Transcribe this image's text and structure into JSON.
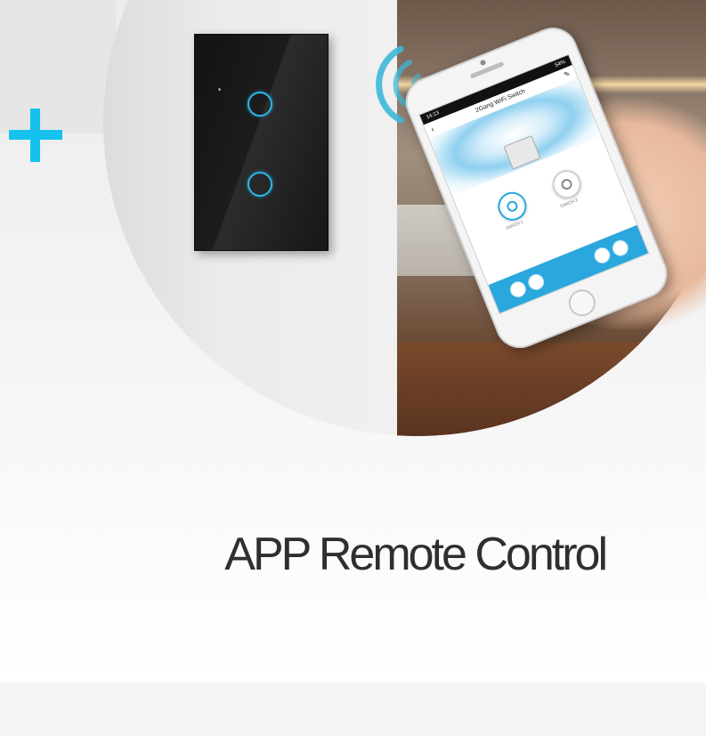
{
  "headline": "APP Remote Control",
  "phone_app": {
    "status_time": "14:13",
    "status_battery": "54%",
    "title": "2Gang WiFi Switch",
    "switch_1_label": "SWICH 1",
    "switch_2_label": "SWICH 2"
  },
  "colors": {
    "accent": "#15c2ee",
    "touch_ring": "#2bb8e8",
    "app_bar": "#2aa7dc",
    "headline_text": "#2f2f2f"
  },
  "icons": [
    "plus-icon",
    "wifi-signal-icon",
    "power-icon",
    "back-arrow-icon",
    "edit-icon"
  ]
}
